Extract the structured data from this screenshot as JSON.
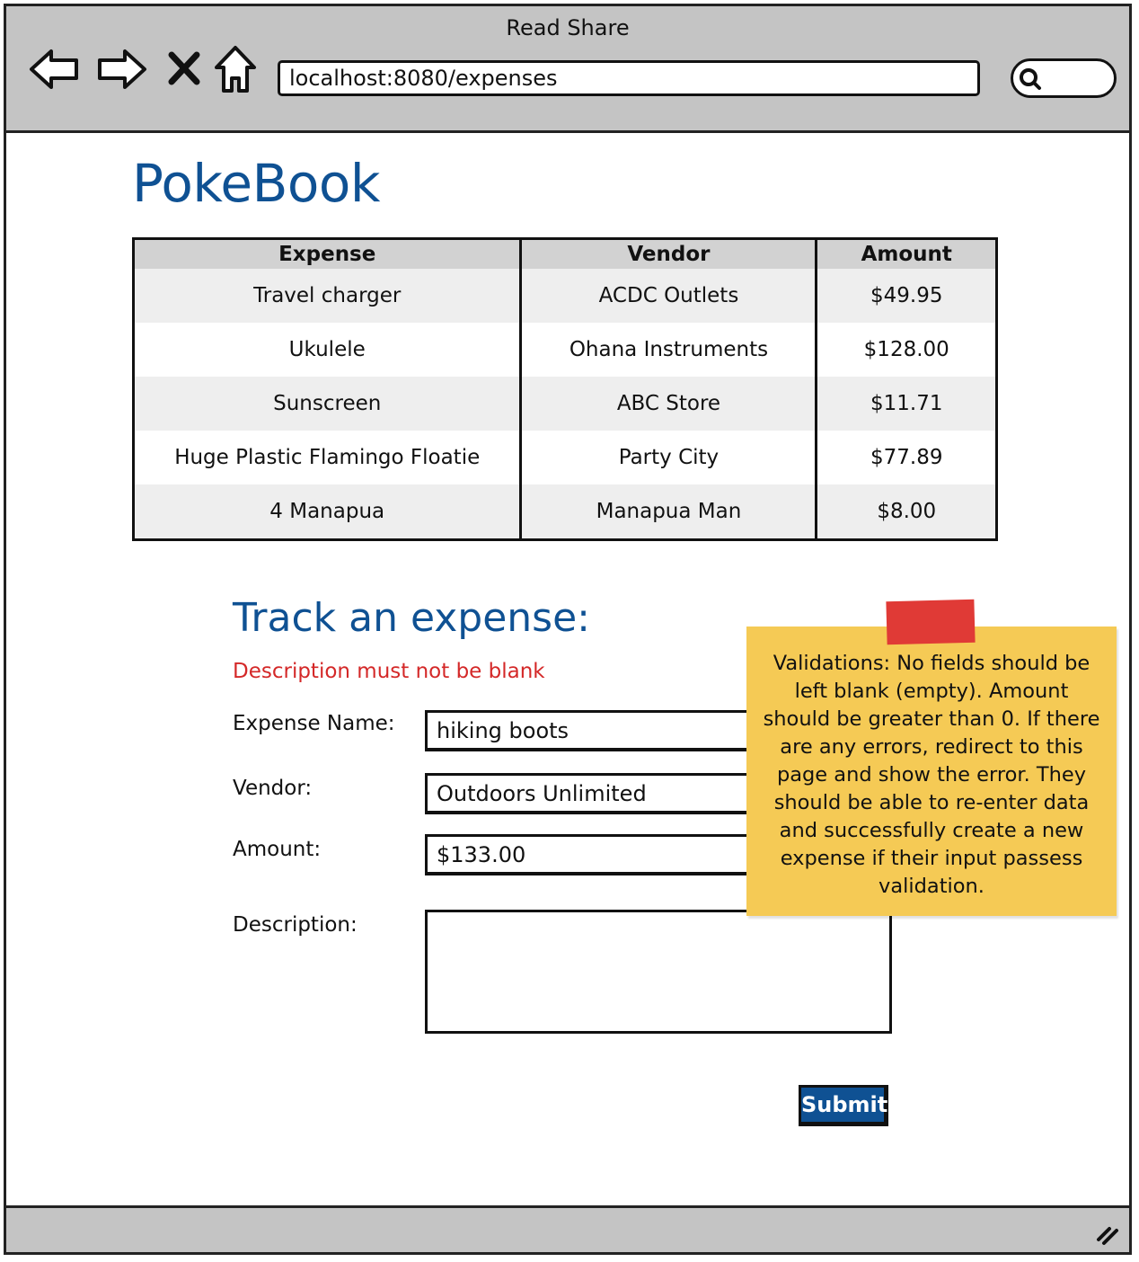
{
  "window": {
    "title": "Read Share",
    "url": "localhost:8080/expenses"
  },
  "app": {
    "title": "PokeBook"
  },
  "table": {
    "headers": [
      "Expense",
      "Vendor",
      "Amount"
    ],
    "rows": [
      [
        "Travel charger",
        "ACDC Outlets",
        "$49.95"
      ],
      [
        "Ukulele",
        "Ohana Instruments",
        "$128.00"
      ],
      [
        "Sunscreen",
        "ABC Store",
        "$11.71"
      ],
      [
        "Huge Plastic Flamingo Floatie",
        "Party City",
        "$77.89"
      ],
      [
        "4 Manapua",
        "Manapua Man",
        "$8.00"
      ]
    ]
  },
  "form": {
    "title": "Track an expense:",
    "error": "Description must not be blank",
    "expense_name_label": "Expense Name:",
    "expense_name_value": "hiking boots",
    "vendor_label": "Vendor:",
    "vendor_value": "Outdoors Unlimited",
    "amount_label": "Amount:",
    "amount_value": "$133.00",
    "description_label": "Description:",
    "description_value": "",
    "submit_label": "Submit"
  },
  "note": {
    "text": "Validations: No fields should be left blank (empty). Amount should be greater than 0. If there are any errors, redirect to this page and show the error. They should be able to re-enter data and successfully create a new expense if their input passess validation."
  },
  "colors": {
    "brand": "#0f5193",
    "error": "#d42828",
    "note": "#f5ca55",
    "tape": "#e03a36"
  },
  "icons": [
    "back-arrow-icon",
    "forward-arrow-icon",
    "stop-icon",
    "home-icon",
    "search-icon",
    "resize-grip-icon"
  ]
}
